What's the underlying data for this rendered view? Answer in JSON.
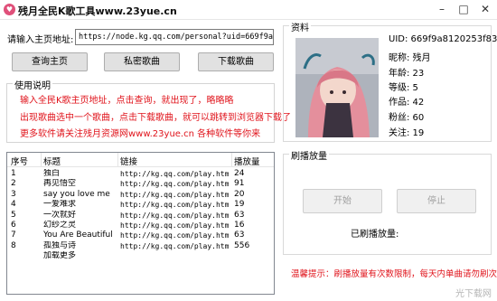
{
  "window": {
    "title": "残月全民K歌工具www.23yue.cn",
    "app_icon": "heart-icon",
    "min_glyph": "–",
    "max_glyph": "□",
    "close_glyph": "✕"
  },
  "form": {
    "url_label": "请输入主页地址:",
    "url_value": "https://node.kg.qq.com/personal?uid=669f9a8120253f83c"
  },
  "buttons": {
    "query_home": "查询主页",
    "private_songs": "私密歌曲",
    "download_songs": "下载歌曲",
    "start": "开始",
    "stop": "停止"
  },
  "instructions": {
    "title": "使用说明",
    "lines": [
      "输入全民K歌主页地址，点击查询，就出现了，略略略",
      "出现歌曲选中一个歌曲，点击下载歌曲，就可以跳转到浏览器下载了",
      "更多软件请关注残月资源网www.23yue.cn 各种软件等你来"
    ],
    "color": "#e0141c"
  },
  "table": {
    "headers": [
      "序号",
      "标题",
      "链接",
      "播放量"
    ],
    "rows": [
      {
        "no": "1",
        "title": "独白",
        "link": "http://kg.qq.com/play.htm...",
        "plays": "24"
      },
      {
        "no": "2",
        "title": "再见悟空",
        "link": "http://kg.qq.com/play.htm...",
        "plays": "91"
      },
      {
        "no": "3",
        "title": "say you love me",
        "link": "http://kg.qq.com/play.htm...",
        "plays": "20"
      },
      {
        "no": "4",
        "title": "一爱难求",
        "link": "http://kg.qq.com/play.htm...",
        "plays": "19"
      },
      {
        "no": "5",
        "title": "一次就好",
        "link": "http://kg.qq.com/play.htm...",
        "plays": "63"
      },
      {
        "no": "6",
        "title": "幻纱之灵",
        "link": "http://kg.qq.com/play.htm...",
        "plays": "16"
      },
      {
        "no": "7",
        "title": "You Are Beautiful",
        "link": "http://kg.qq.com/play.htm...",
        "plays": "63"
      },
      {
        "no": "8",
        "title": "孤独与诗",
        "link": "http://kg.qq.com/play.htm...",
        "plays": "556"
      },
      {
        "no": "",
        "title": "加载更多",
        "link": "",
        "plays": ""
      }
    ]
  },
  "profile": {
    "title": "资料",
    "uid": "UID: 669f9a8120253f833c",
    "nickname": "昵称: 残月",
    "age": "年龄: 23",
    "level": "等级: 5",
    "works": "作品: 42",
    "fans": "粉丝: 60",
    "following": "关注: 19"
  },
  "play": {
    "title": "刷播放量",
    "played_label": "已刷播放量:",
    "tip": "温馨提示：刷播放量有次数限制，每天内单曲请勿刷次数"
  },
  "watermark": "光下载网"
}
